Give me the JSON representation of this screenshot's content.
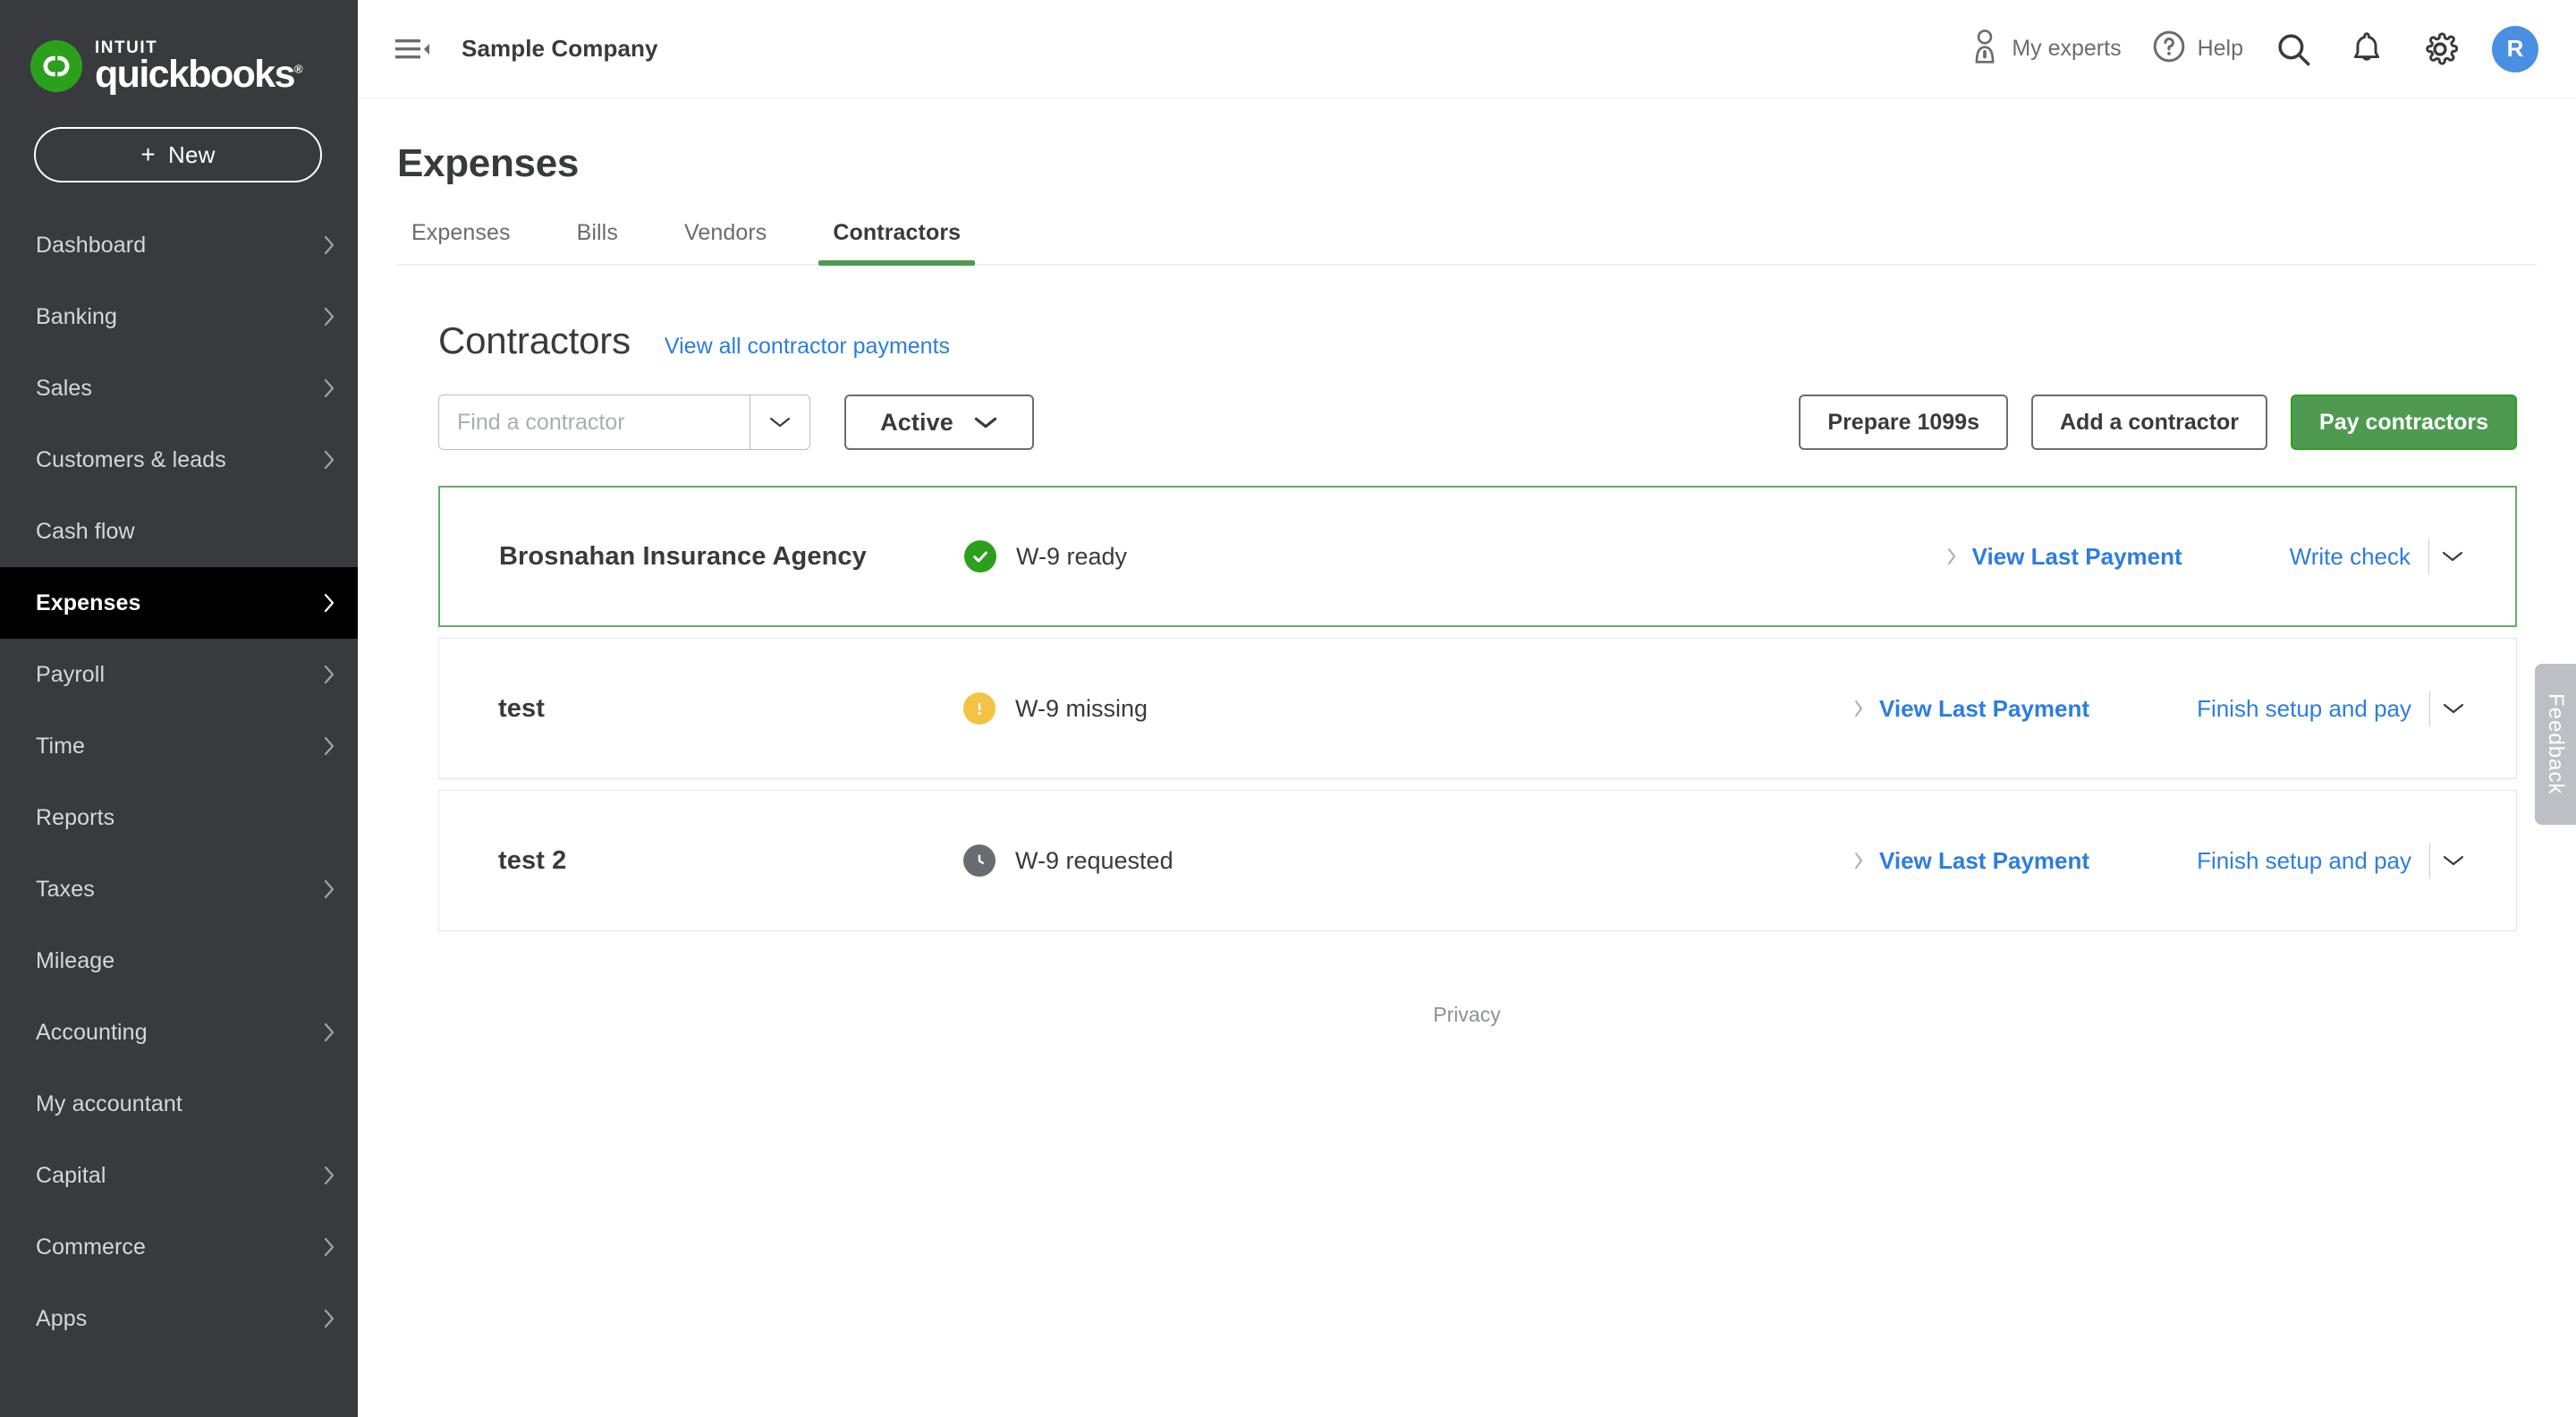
{
  "brand": {
    "intuit": "INTUIT",
    "name": "quickbooks",
    "registered": "®"
  },
  "sidebar": {
    "new_button": "New",
    "new_plus": "+",
    "items": [
      {
        "label": "Dashboard",
        "chevron": true,
        "active": false
      },
      {
        "label": "Banking",
        "chevron": true,
        "active": false
      },
      {
        "label": "Sales",
        "chevron": true,
        "active": false
      },
      {
        "label": "Customers & leads",
        "chevron": true,
        "active": false
      },
      {
        "label": "Cash flow",
        "chevron": false,
        "active": false
      },
      {
        "label": "Expenses",
        "chevron": true,
        "active": true
      },
      {
        "label": "Payroll",
        "chevron": true,
        "active": false
      },
      {
        "label": "Time",
        "chevron": true,
        "active": false
      },
      {
        "label": "Reports",
        "chevron": false,
        "active": false
      },
      {
        "label": "Taxes",
        "chevron": true,
        "active": false
      },
      {
        "label": "Mileage",
        "chevron": false,
        "active": false
      },
      {
        "label": "Accounting",
        "chevron": true,
        "active": false
      },
      {
        "label": "My accountant",
        "chevron": false,
        "active": false
      },
      {
        "label": "Capital",
        "chevron": true,
        "active": false
      },
      {
        "label": "Commerce",
        "chevron": true,
        "active": false
      },
      {
        "label": "Apps",
        "chevron": true,
        "active": false
      }
    ]
  },
  "topbar": {
    "company": "Sample Company",
    "my_experts": "My experts",
    "help": "Help",
    "avatar_initial": "R"
  },
  "page": {
    "title": "Expenses",
    "tabs": [
      {
        "label": "Expenses",
        "active": false
      },
      {
        "label": "Bills",
        "active": false
      },
      {
        "label": "Vendors",
        "active": false
      },
      {
        "label": "Contractors",
        "active": true
      }
    ]
  },
  "section": {
    "title": "Contractors",
    "view_all_link": "View all contractor payments"
  },
  "toolbar": {
    "search_placeholder": "Find a contractor",
    "search_value": "",
    "filter_value": "Active",
    "prepare_1099s": "Prepare 1099s",
    "add_contractor": "Add a contractor",
    "pay_contractors": "Pay contractors"
  },
  "contractors": [
    {
      "name": "Brosnahan Insurance Agency",
      "status": "W-9 ready",
      "status_type": "ready",
      "view_last_payment": "View Last Payment",
      "action": "Write check",
      "highlight": true
    },
    {
      "name": "test",
      "status": "W-9 missing",
      "status_type": "missing",
      "view_last_payment": "View Last Payment",
      "action": "Finish setup and pay",
      "highlight": false
    },
    {
      "name": "test 2",
      "status": "W-9 requested",
      "status_type": "requested",
      "view_last_payment": "View Last Payment",
      "action": "Finish setup and pay",
      "highlight": false
    }
  ],
  "footer": {
    "privacy": "Privacy"
  },
  "feedback": {
    "label": "Feedback"
  },
  "colors": {
    "sidebar_bg": "#393a3d",
    "active_nav_bg": "#000000",
    "brand_green": "#2ca01c",
    "button_green": "#4e9a51",
    "link_blue": "#2c7de0",
    "avatar_blue": "#4a90e2",
    "warn_yellow": "#f4c244",
    "neutral_gray": "#6b6c72"
  }
}
